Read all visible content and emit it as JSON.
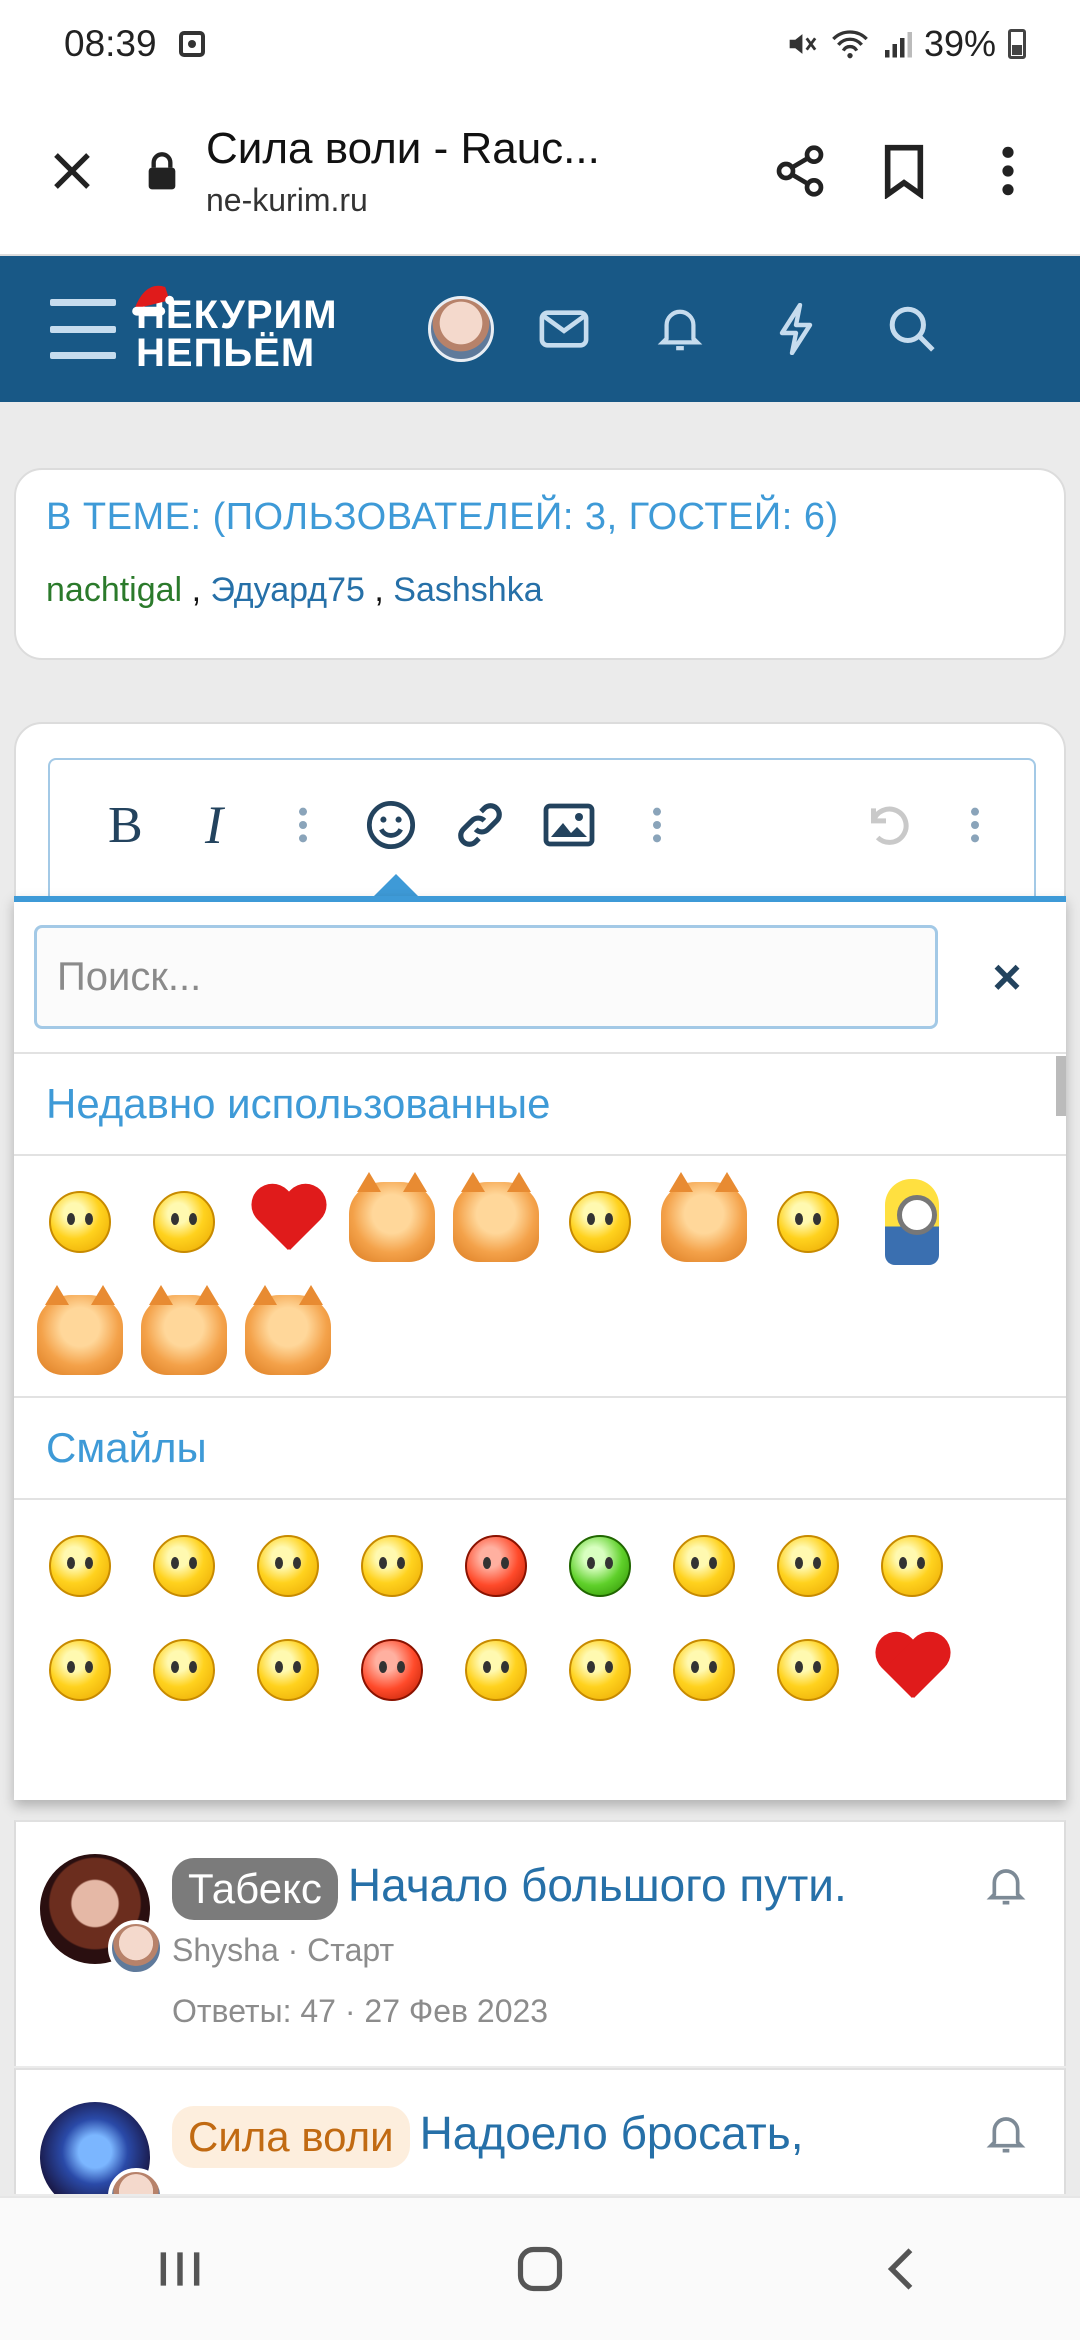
{
  "status_bar": {
    "time": "08:39",
    "battery": "39%"
  },
  "browser": {
    "title": "Сила воли - Rauc...",
    "url": "ne-kurim.ru"
  },
  "site": {
    "logo_line1": "НЕКУРИМ",
    "logo_line2": "НЕПЬЁМ",
    "accent": "#185886"
  },
  "who": {
    "title": "В ТЕМЕ: (ПОЛЬЗОВАТЕЛЕЙ: 3, ГОСТЕЙ: 6)",
    "users": [
      "nachtigal",
      "Эдуард75",
      "Sashshka"
    ],
    "separator": ","
  },
  "editor": {
    "bold": "B",
    "italic": "I"
  },
  "emoji_panel": {
    "search_placeholder": "Поиск...",
    "close_symbol": "×",
    "recent_title": "Недавно использованные",
    "smileys_title": "Смайлы"
  },
  "threads": [
    {
      "tag": "Табекс",
      "title": "Начало большого пути.",
      "author": "Shysha",
      "forum": "Старт",
      "replies_label": "Ответы: 47",
      "date": "27 Фев 2023",
      "dot": "·"
    },
    {
      "tag": "Сила воли",
      "title": "Надоело бросать,"
    }
  ]
}
